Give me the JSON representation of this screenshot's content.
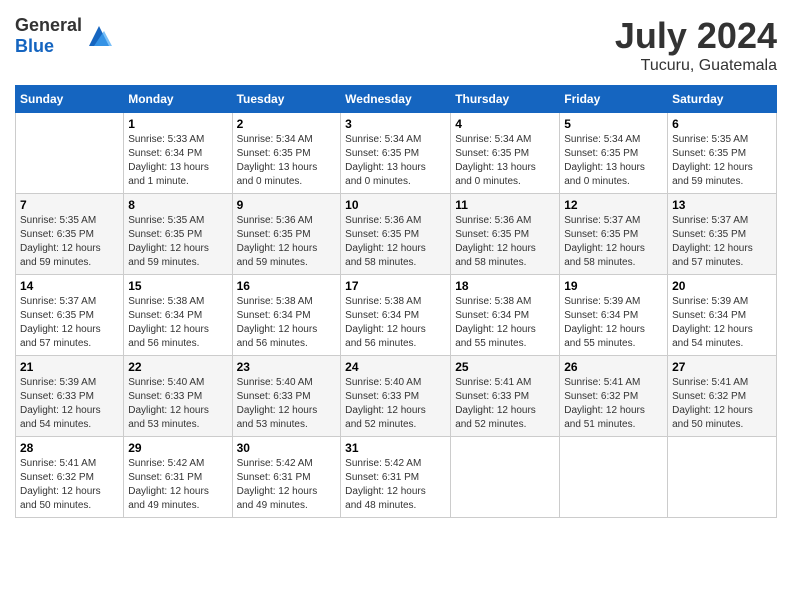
{
  "header": {
    "logo_general": "General",
    "logo_blue": "Blue",
    "month": "July 2024",
    "location": "Tucuru, Guatemala"
  },
  "days_of_week": [
    "Sunday",
    "Monday",
    "Tuesday",
    "Wednesday",
    "Thursday",
    "Friday",
    "Saturday"
  ],
  "weeks": [
    [
      {
        "day": "",
        "info": ""
      },
      {
        "day": "1",
        "info": "Sunrise: 5:33 AM\nSunset: 6:34 PM\nDaylight: 13 hours\nand 1 minute."
      },
      {
        "day": "2",
        "info": "Sunrise: 5:34 AM\nSunset: 6:35 PM\nDaylight: 13 hours\nand 0 minutes."
      },
      {
        "day": "3",
        "info": "Sunrise: 5:34 AM\nSunset: 6:35 PM\nDaylight: 13 hours\nand 0 minutes."
      },
      {
        "day": "4",
        "info": "Sunrise: 5:34 AM\nSunset: 6:35 PM\nDaylight: 13 hours\nand 0 minutes."
      },
      {
        "day": "5",
        "info": "Sunrise: 5:34 AM\nSunset: 6:35 PM\nDaylight: 13 hours\nand 0 minutes."
      },
      {
        "day": "6",
        "info": "Sunrise: 5:35 AM\nSunset: 6:35 PM\nDaylight: 12 hours\nand 59 minutes."
      }
    ],
    [
      {
        "day": "7",
        "info": "Sunrise: 5:35 AM\nSunset: 6:35 PM\nDaylight: 12 hours\nand 59 minutes."
      },
      {
        "day": "8",
        "info": "Sunrise: 5:35 AM\nSunset: 6:35 PM\nDaylight: 12 hours\nand 59 minutes."
      },
      {
        "day": "9",
        "info": "Sunrise: 5:36 AM\nSunset: 6:35 PM\nDaylight: 12 hours\nand 59 minutes."
      },
      {
        "day": "10",
        "info": "Sunrise: 5:36 AM\nSunset: 6:35 PM\nDaylight: 12 hours\nand 58 minutes."
      },
      {
        "day": "11",
        "info": "Sunrise: 5:36 AM\nSunset: 6:35 PM\nDaylight: 12 hours\nand 58 minutes."
      },
      {
        "day": "12",
        "info": "Sunrise: 5:37 AM\nSunset: 6:35 PM\nDaylight: 12 hours\nand 58 minutes."
      },
      {
        "day": "13",
        "info": "Sunrise: 5:37 AM\nSunset: 6:35 PM\nDaylight: 12 hours\nand 57 minutes."
      }
    ],
    [
      {
        "day": "14",
        "info": "Sunrise: 5:37 AM\nSunset: 6:35 PM\nDaylight: 12 hours\nand 57 minutes."
      },
      {
        "day": "15",
        "info": "Sunrise: 5:38 AM\nSunset: 6:34 PM\nDaylight: 12 hours\nand 56 minutes."
      },
      {
        "day": "16",
        "info": "Sunrise: 5:38 AM\nSunset: 6:34 PM\nDaylight: 12 hours\nand 56 minutes."
      },
      {
        "day": "17",
        "info": "Sunrise: 5:38 AM\nSunset: 6:34 PM\nDaylight: 12 hours\nand 56 minutes."
      },
      {
        "day": "18",
        "info": "Sunrise: 5:38 AM\nSunset: 6:34 PM\nDaylight: 12 hours\nand 55 minutes."
      },
      {
        "day": "19",
        "info": "Sunrise: 5:39 AM\nSunset: 6:34 PM\nDaylight: 12 hours\nand 55 minutes."
      },
      {
        "day": "20",
        "info": "Sunrise: 5:39 AM\nSunset: 6:34 PM\nDaylight: 12 hours\nand 54 minutes."
      }
    ],
    [
      {
        "day": "21",
        "info": "Sunrise: 5:39 AM\nSunset: 6:33 PM\nDaylight: 12 hours\nand 54 minutes."
      },
      {
        "day": "22",
        "info": "Sunrise: 5:40 AM\nSunset: 6:33 PM\nDaylight: 12 hours\nand 53 minutes."
      },
      {
        "day": "23",
        "info": "Sunrise: 5:40 AM\nSunset: 6:33 PM\nDaylight: 12 hours\nand 53 minutes."
      },
      {
        "day": "24",
        "info": "Sunrise: 5:40 AM\nSunset: 6:33 PM\nDaylight: 12 hours\nand 52 minutes."
      },
      {
        "day": "25",
        "info": "Sunrise: 5:41 AM\nSunset: 6:33 PM\nDaylight: 12 hours\nand 52 minutes."
      },
      {
        "day": "26",
        "info": "Sunrise: 5:41 AM\nSunset: 6:32 PM\nDaylight: 12 hours\nand 51 minutes."
      },
      {
        "day": "27",
        "info": "Sunrise: 5:41 AM\nSunset: 6:32 PM\nDaylight: 12 hours\nand 50 minutes."
      }
    ],
    [
      {
        "day": "28",
        "info": "Sunrise: 5:41 AM\nSunset: 6:32 PM\nDaylight: 12 hours\nand 50 minutes."
      },
      {
        "day": "29",
        "info": "Sunrise: 5:42 AM\nSunset: 6:31 PM\nDaylight: 12 hours\nand 49 minutes."
      },
      {
        "day": "30",
        "info": "Sunrise: 5:42 AM\nSunset: 6:31 PM\nDaylight: 12 hours\nand 49 minutes."
      },
      {
        "day": "31",
        "info": "Sunrise: 5:42 AM\nSunset: 6:31 PM\nDaylight: 12 hours\nand 48 minutes."
      },
      {
        "day": "",
        "info": ""
      },
      {
        "day": "",
        "info": ""
      },
      {
        "day": "",
        "info": ""
      }
    ]
  ]
}
